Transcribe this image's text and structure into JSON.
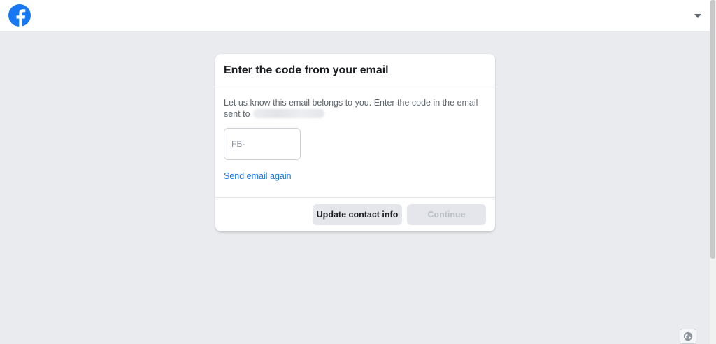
{
  "header": {
    "logo_icon": "facebook-logo-icon",
    "menu_icon": "caret-down-icon",
    "brand_color": "#1877f2"
  },
  "dialog": {
    "title": "Enter the code from your email",
    "description_prefix": "Let us know this email belongs to you. Enter the code in the email sent to",
    "code_field": {
      "placeholder": "FB-",
      "value": ""
    },
    "resend_link": "Send email again",
    "buttons": {
      "update_contact": "Update contact info",
      "continue": "Continue"
    }
  },
  "footer": {
    "language_icon": "globe-icon"
  }
}
